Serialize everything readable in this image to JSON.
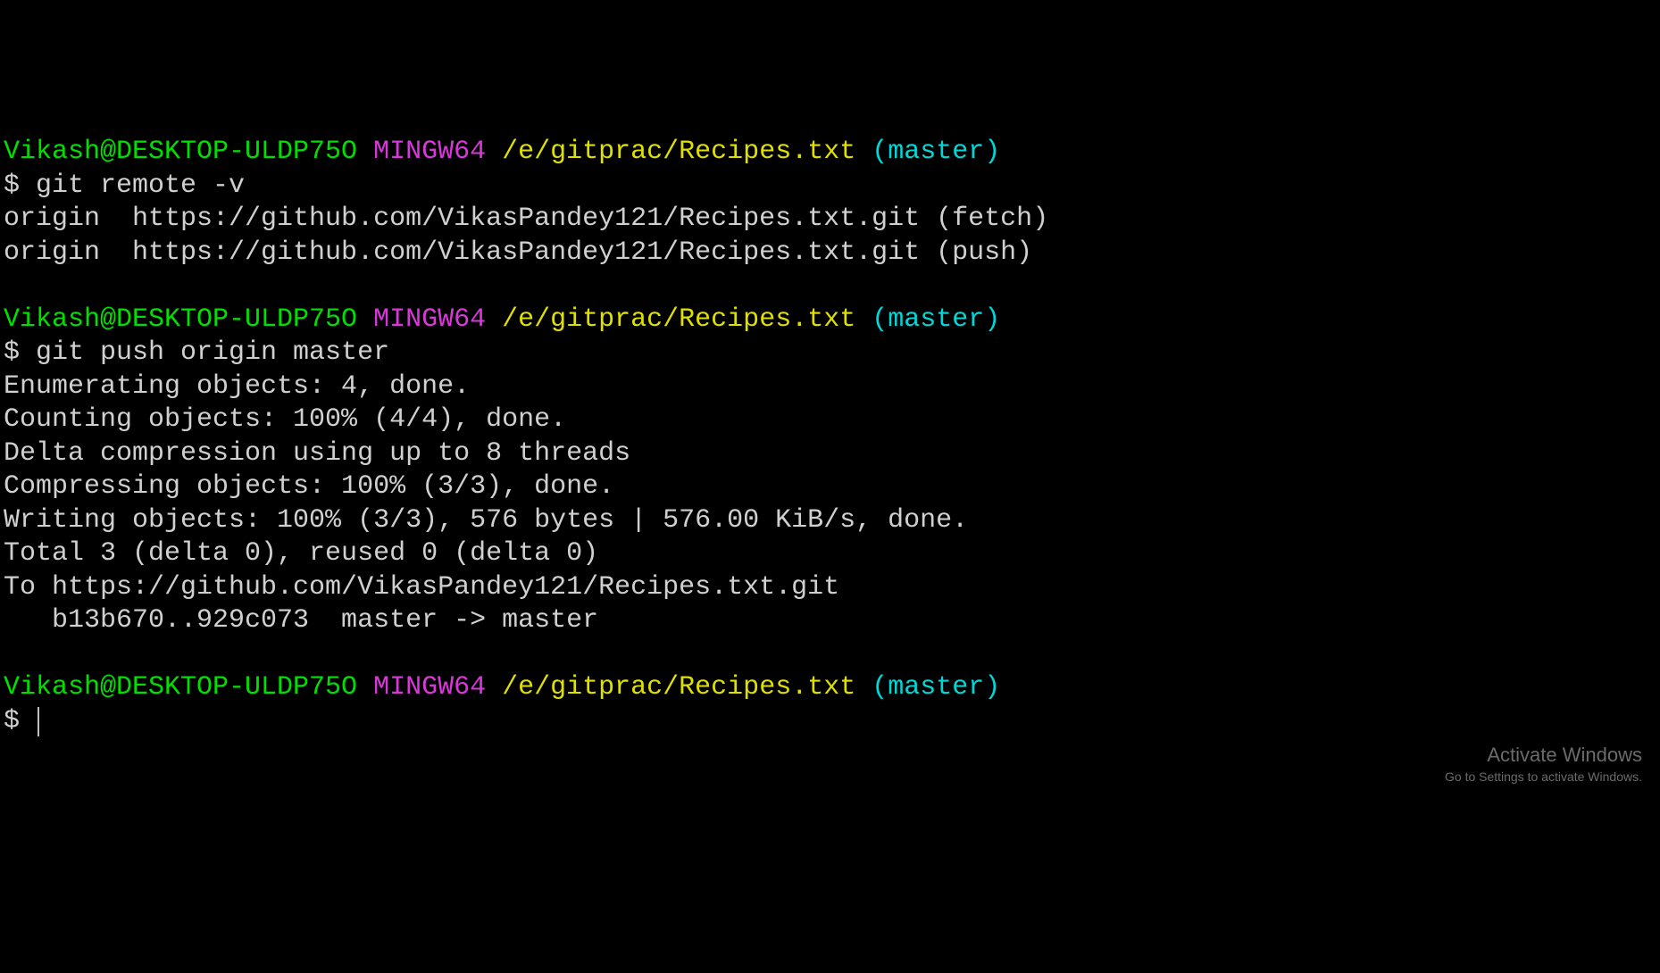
{
  "prompts": [
    {
      "user": "Vikash@DESKTOP-ULDP75O",
      "env": "MINGW64",
      "path": "/e/gitprac/Recipes.txt",
      "branch": "(master)"
    },
    {
      "user": "Vikash@DESKTOP-ULDP75O",
      "env": "MINGW64",
      "path": "/e/gitprac/Recipes.txt",
      "branch": "(master)"
    },
    {
      "user": "Vikash@DESKTOP-ULDP75O",
      "env": "MINGW64",
      "path": "/e/gitprac/Recipes.txt",
      "branch": "(master)"
    }
  ],
  "commands": {
    "cmd1": "$ git remote -v",
    "cmd2": "$ git push origin master",
    "cmd3": "$ "
  },
  "output": {
    "remote_fetch": "origin  https://github.com/VikasPandey121/Recipes.txt.git (fetch)",
    "remote_push": "origin  https://github.com/VikasPandey121/Recipes.txt.git (push)",
    "push_enum": "Enumerating objects: 4, done.",
    "push_count": "Counting objects: 100% (4/4), done.",
    "push_delta": "Delta compression using up to 8 threads",
    "push_compress": "Compressing objects: 100% (3/3), done.",
    "push_write": "Writing objects: 100% (3/3), 576 bytes | 576.00 KiB/s, done.",
    "push_total": "Total 3 (delta 0), reused 0 (delta 0)",
    "push_to": "To https://github.com/VikasPandey121/Recipes.txt.git",
    "push_ref": "   b13b670..929c073  master -> master"
  },
  "watermark": {
    "line1": "Activate Windows",
    "line2": "Go to Settings to activate Windows."
  }
}
